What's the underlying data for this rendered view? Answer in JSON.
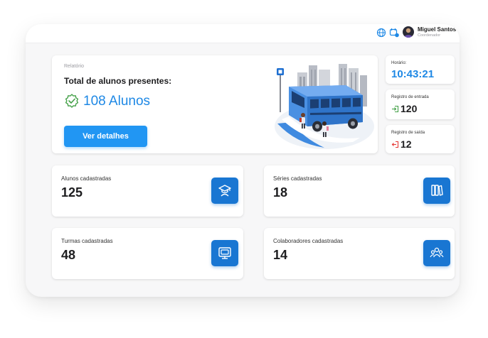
{
  "header": {
    "user_name": "Miguel Santos",
    "user_role": "Coordenador",
    "icons": [
      "globe-icon",
      "notification-icon"
    ]
  },
  "relatorio": {
    "label": "Relatório",
    "title": "Total de alunos presentes:",
    "count": "108 Alunos",
    "button_label": "Ver detalhes"
  },
  "horario": {
    "label": "Horário:",
    "time": "10:43:21"
  },
  "entrada": {
    "label": "Registro de entrada",
    "value": "120"
  },
  "saida": {
    "label": "Registro de saída",
    "value": "12"
  },
  "stats": [
    {
      "label": "Alunos cadastradas",
      "value": "125",
      "icon": "graduate-icon"
    },
    {
      "label": "Séries cadastradas",
      "value": "18",
      "icon": "books-icon"
    },
    {
      "label": "Turmas cadastradas",
      "value": "48",
      "icon": "classroom-icon"
    },
    {
      "label": "Colaboradores cadastradas",
      "value": "14",
      "icon": "team-icon"
    }
  ],
  "colors": {
    "accent": "#1e88e5",
    "button": "#2196f3",
    "icon_tile": "#1976d2",
    "entrada": "#43a047",
    "saida": "#e53935"
  }
}
